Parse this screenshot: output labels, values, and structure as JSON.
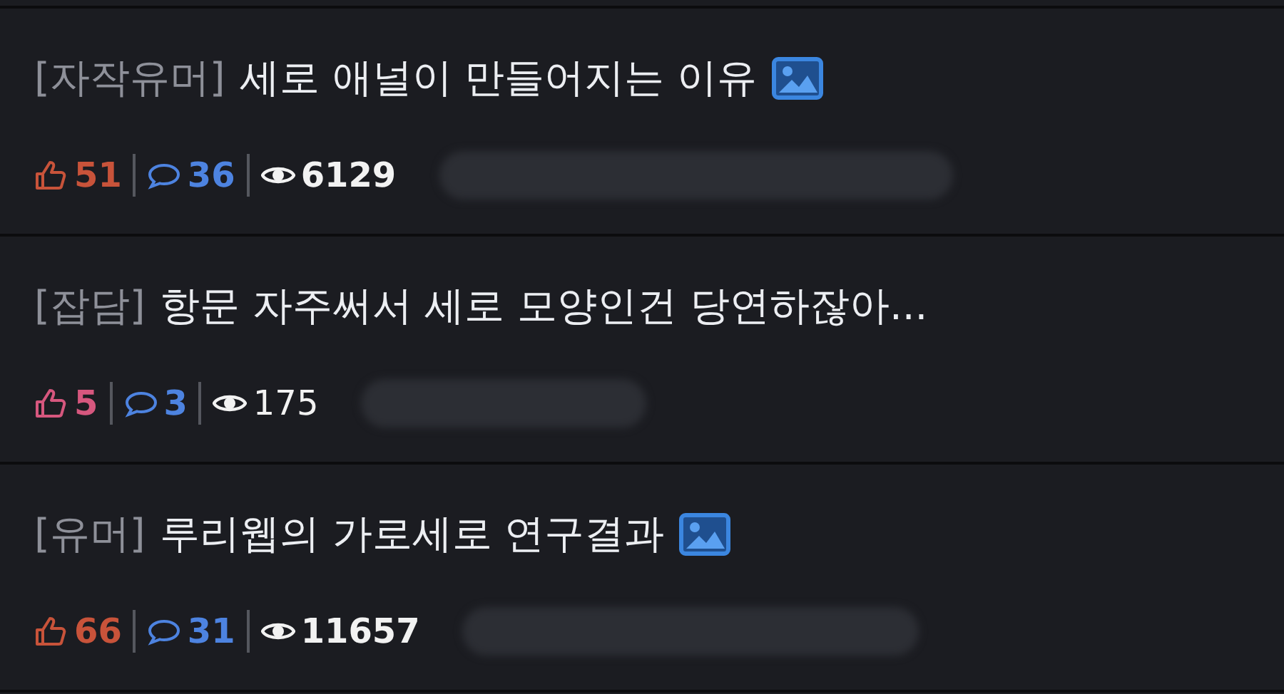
{
  "posts": [
    {
      "category": "[자작유머]",
      "title": "세로 애널이 만들어지는 이유",
      "has_image": true,
      "popular": true,
      "likes": "51",
      "comments": "36",
      "views": "6129"
    },
    {
      "category": "[잡담]",
      "title": "항문 자주써서 세로 모양인건 당연하잖아...",
      "has_image": false,
      "popular": false,
      "likes": "5",
      "comments": "3",
      "views": "175"
    },
    {
      "category": "[유머]",
      "title": "루리웹의 가로세로 연구결과",
      "has_image": true,
      "popular": true,
      "likes": "66",
      "comments": "31",
      "views": "11657"
    }
  ]
}
